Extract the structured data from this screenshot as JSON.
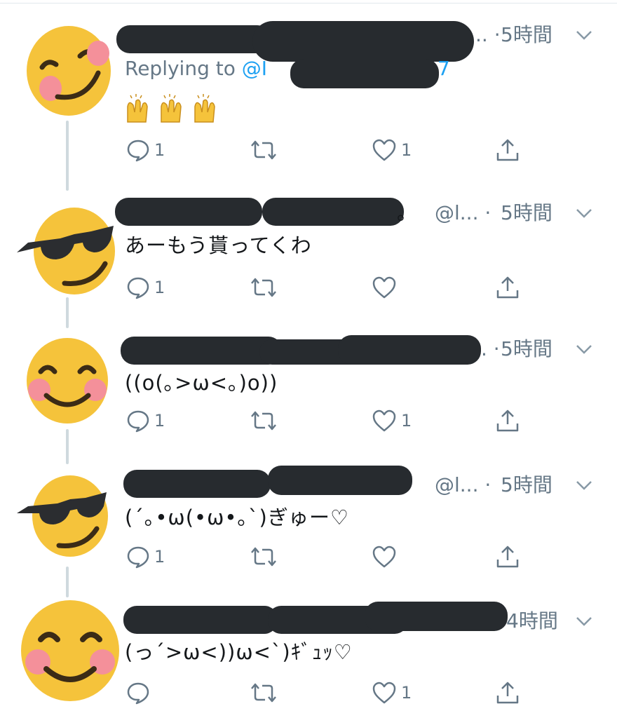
{
  "tweets": [
    {
      "time": "5時間",
      "truncated_handle": ".. ·",
      "reply_label": "Replying to",
      "reply_handle_start": "@I",
      "reply_handle_end": "7",
      "emoji_content": "raising-hands x3",
      "reply_count": "1",
      "like_count": "1",
      "avatar": "smiling-face-emoji"
    },
    {
      "time": "5時間",
      "truncated_handle": "@l... ·",
      "name_suffix": "。",
      "text": "あーもう貰ってくわ",
      "reply_count": "1",
      "like_count": "",
      "avatar": "sunglasses-emoji"
    },
    {
      "time": "5時間",
      "truncated_handle": ". ·",
      "text": "((o(｡>ω<｡)o))",
      "reply_count": "1",
      "like_count": "1",
      "avatar": "blushing-smile-emoji"
    },
    {
      "time": "5時間",
      "truncated_handle": "@l... ·",
      "text": "(´｡•ω(•ω•｡`)ぎゅー♡",
      "reply_count": "1",
      "like_count": "",
      "avatar": "sunglasses-emoji"
    },
    {
      "time": "4時間",
      "truncated_handle": "",
      "text": "(っ´>ω<))ω<`)ｷﾞｭｯ♡",
      "reply_count": "",
      "like_count": "1",
      "avatar": "blushing-smile-emoji"
    }
  ],
  "colors": {
    "accent": "#1da1f2",
    "muted": "#657786",
    "redaction": "#272b2f",
    "emoji_yellow": "#f5c33b",
    "blush": "#f4909a"
  }
}
